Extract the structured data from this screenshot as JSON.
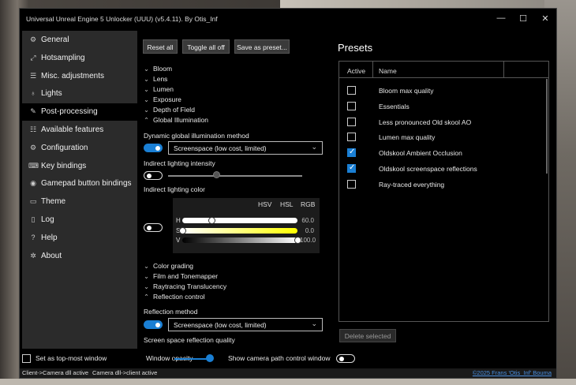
{
  "window": {
    "title": "Universal Unreal Engine 5 Unlocker (UUU) (v5.4.11). By Otis_Inf",
    "minimize": "—",
    "maximize": "☐",
    "close": "✕"
  },
  "sidebar": {
    "items": [
      {
        "label": "General",
        "icon": "gear-icon",
        "glyph": "⚙"
      },
      {
        "label": "Hotsampling",
        "icon": "resize-icon",
        "glyph": "⤢"
      },
      {
        "label": "Misc. adjustments",
        "icon": "sliders-icon",
        "glyph": "☰"
      },
      {
        "label": "Lights",
        "icon": "bulb-icon",
        "glyph": "♁"
      },
      {
        "label": "Post-processing",
        "icon": "pencil-icon",
        "glyph": "✎",
        "active": true
      },
      {
        "label": "Available features",
        "icon": "list-icon",
        "glyph": "☷"
      },
      {
        "label": "Configuration",
        "icon": "gear-icon",
        "glyph": "⚙"
      },
      {
        "label": "Key bindings",
        "icon": "keyboard-icon",
        "glyph": "⌨"
      },
      {
        "label": "Gamepad button bindings",
        "icon": "gamepad-icon",
        "glyph": "◉"
      },
      {
        "label": "Theme",
        "icon": "theme-icon",
        "glyph": "▭"
      },
      {
        "label": "Log",
        "icon": "log-icon",
        "glyph": "▯"
      },
      {
        "label": "Help",
        "icon": "help-icon",
        "glyph": "?"
      },
      {
        "label": "About",
        "icon": "info-icon",
        "glyph": "✲"
      }
    ]
  },
  "toolbar": {
    "reset_all": "Reset all",
    "toggle_all_off": "Toggle all off",
    "save_as_preset": "Save as preset..."
  },
  "sections_top": [
    {
      "label": "Bloom",
      "chevron": "⌄"
    },
    {
      "label": "Lens",
      "chevron": "⌄"
    },
    {
      "label": "Lumen",
      "chevron": "⌄"
    },
    {
      "label": "Exposure",
      "chevron": "⌄"
    },
    {
      "label": "Depth of Field",
      "chevron": "⌄"
    },
    {
      "label": "Global Illumination",
      "chevron": "⌃"
    }
  ],
  "gi": {
    "method_label": "Dynamic global illumination method",
    "method_toggle_on": true,
    "method_value": "Screenspace (low cost, limited)",
    "intensity_label": "Indirect lighting intensity",
    "intensity_toggle_on": false,
    "intensity_fraction": 0.36,
    "color_label": "Indirect lighting color",
    "color_toggle_on": false,
    "picker_tabs": [
      "HSV",
      "HSL",
      "RGB"
    ],
    "picker_rows": [
      {
        "label": "H",
        "value": "60.0",
        "fraction": 0.25
      },
      {
        "label": "S",
        "value": "0.0",
        "fraction": 0.0
      },
      {
        "label": "V",
        "value": "100.0",
        "fraction": 1.0
      }
    ]
  },
  "sections_bottom": [
    {
      "label": "Color grading",
      "chevron": "⌄"
    },
    {
      "label": "Film and Tonemapper",
      "chevron": "⌄"
    },
    {
      "label": "Raytracing Translucency",
      "chevron": "⌄"
    },
    {
      "label": "Reflection control",
      "chevron": "⌃"
    }
  ],
  "reflection": {
    "method_label": "Reflection method",
    "method_toggle_on": true,
    "method_value": "Screenspace (low cost, limited)",
    "quality_label": "Screen space reflection quality"
  },
  "presets": {
    "title": "Presets",
    "col_active": "Active",
    "col_name": "Name",
    "items": [
      {
        "name": "Bloom max quality",
        "active": false
      },
      {
        "name": "Essentials",
        "active": false
      },
      {
        "name": "Less pronounced Old skool AO",
        "active": false
      },
      {
        "name": "Lumen max quality",
        "active": false
      },
      {
        "name": "Oldskool Ambient Occlusion",
        "active": true
      },
      {
        "name": "Oldskool screenspace reflections",
        "active": true
      },
      {
        "name": "Ray-traced everything",
        "active": false
      }
    ],
    "delete_label": "Delete selected"
  },
  "bottom": {
    "top_most_label": "Set as top-most window",
    "opacity_label": "Window opacity",
    "opacity_fraction": 1.0,
    "camera_path_label": "Show camera path control window",
    "camera_path_on": false
  },
  "status": {
    "left1": "Client->Camera dll active",
    "left2": "Camera dll->client active",
    "credit": "©2025 Frans 'Otis_Inf' Bouma"
  },
  "colors": {
    "accent": "#1a7fd4",
    "sidebar_bg": "#2b2b2b",
    "window_bg": "#000000"
  }
}
